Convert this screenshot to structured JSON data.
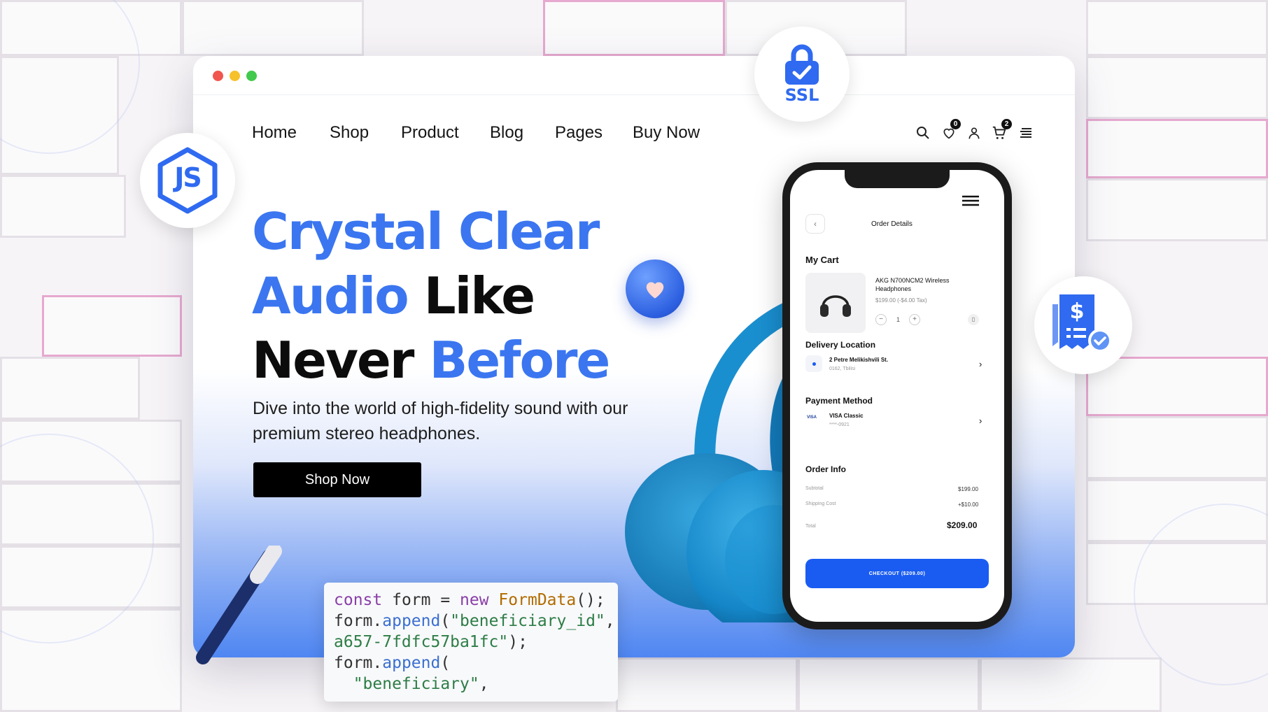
{
  "nav": {
    "links": [
      "Home",
      "Shop",
      "Product",
      "Blog",
      "Pages",
      "Buy Now"
    ],
    "wishlist_count": "0",
    "cart_count": "2"
  },
  "hero": {
    "line1": "Crystal Clear",
    "line2_blue": "Audio",
    "line2_black": "Like",
    "line3_black": "Never",
    "line3_blue": "Before",
    "subtitle": "Dive into the world of high-fidelity sound with our premium stereo headphones.",
    "cta": "Shop Now"
  },
  "phone": {
    "header": "Order Details",
    "cart_title": "My Cart",
    "product_name": "AKG N700NCM2 Wireless Headphones",
    "product_price": "$199.00 (-$4.00 Tax)",
    "quantity": "1",
    "delivery_title": "Delivery Location",
    "address_line1": "2 Petre Melikishvili St.",
    "address_line2": "0162, Tbilisi",
    "payment_title": "Payment Method",
    "card_brand": "VISA",
    "card_name": "VISA Classic",
    "card_number": "****-0921",
    "order_info_title": "Order Info",
    "subtotal_label": "Subtotal",
    "subtotal_value": "$199.00",
    "shipping_label": "Shipping Cost",
    "shipping_value": "+$10.00",
    "total_label": "Total",
    "total_value": "$209.00",
    "checkout": "CHECKOUT ($209.00)"
  },
  "badges": {
    "ssl": "SSL",
    "js": "JS"
  },
  "code": {
    "l1_kw": "const",
    "l1_var": " form = ",
    "l1_new": "new",
    "l1_cls": " FormData",
    "l1_end": "();",
    "l2_obj": "form.",
    "l2_fn": "append",
    "l2_open": "(",
    "l2_str": "\"beneficiary_id\"",
    "l2_end": ",",
    "l3_str": "a657-7fdfc57ba1fc\"",
    "l3_end": ");",
    "l4_obj": "form.",
    "l4_fn": "append",
    "l4_end": "(",
    "l5_str": "  \"beneficiary\"",
    "l5_end": ","
  },
  "colors": {
    "accent": "#3b76f0",
    "checkout_button": "#1a5cf2",
    "dot_red": "#f0554e",
    "dot_yellow": "#f6c12b",
    "dot_green": "#42c94e"
  }
}
